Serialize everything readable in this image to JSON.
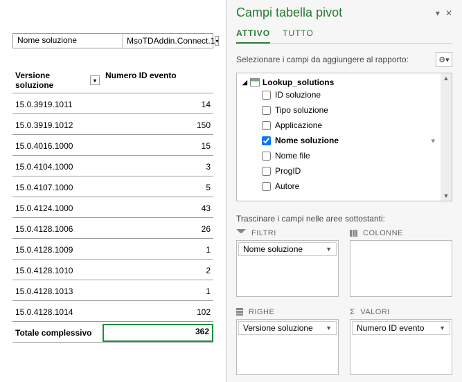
{
  "filter": {
    "label": "Nome soluzione",
    "value": "MsoTDAddin.Connect.1"
  },
  "pivot": {
    "col1": "Versione soluzione",
    "col2": "Numero ID evento",
    "rows": [
      {
        "v": "15.0.3919.1011",
        "n": "14"
      },
      {
        "v": "15.0.3919.1012",
        "n": "150"
      },
      {
        "v": "15.0.4016.1000",
        "n": "15"
      },
      {
        "v": "15.0.4104.1000",
        "n": "3"
      },
      {
        "v": "15.0.4107.1000",
        "n": "5"
      },
      {
        "v": "15.0.4124.1000",
        "n": "43"
      },
      {
        "v": "15.0.4128.1006",
        "n": "26"
      },
      {
        "v": "15.0.4128.1009",
        "n": "1"
      },
      {
        "v": "15.0.4128.1010",
        "n": "2"
      },
      {
        "v": "15.0.4128.1013",
        "n": "1"
      },
      {
        "v": "15.0.4128.1014",
        "n": "102"
      }
    ],
    "total_label": "Totale complessivo",
    "total_value": "362"
  },
  "pane": {
    "title": "Campi tabella pivot",
    "tab_active": "ATTIVO",
    "tab_all": "TUTTO",
    "subtitle": "Selezionare i campi da aggiungere al rapporto:",
    "gear": "⚙",
    "table_name": "Lookup_solutions",
    "fields": [
      {
        "label": "ID soluzione",
        "checked": false
      },
      {
        "label": "Tipo soluzione",
        "checked": false
      },
      {
        "label": "Applicazione",
        "checked": false
      },
      {
        "label": "Nome soluzione",
        "checked": true
      },
      {
        "label": "Nome file",
        "checked": false
      },
      {
        "label": "ProgID",
        "checked": false
      },
      {
        "label": "Autore",
        "checked": false
      }
    ],
    "drag_label": "Trascinare i campi nelle aree sottostanti:",
    "areas": {
      "filters": {
        "title": "FILTRI",
        "chip": "Nome soluzione"
      },
      "columns": {
        "title": "COLONNE"
      },
      "rows": {
        "title": "RIGHE",
        "chip": "Versione soluzione"
      },
      "values": {
        "title": "VALORI",
        "chip": "Numero ID evento"
      }
    }
  }
}
